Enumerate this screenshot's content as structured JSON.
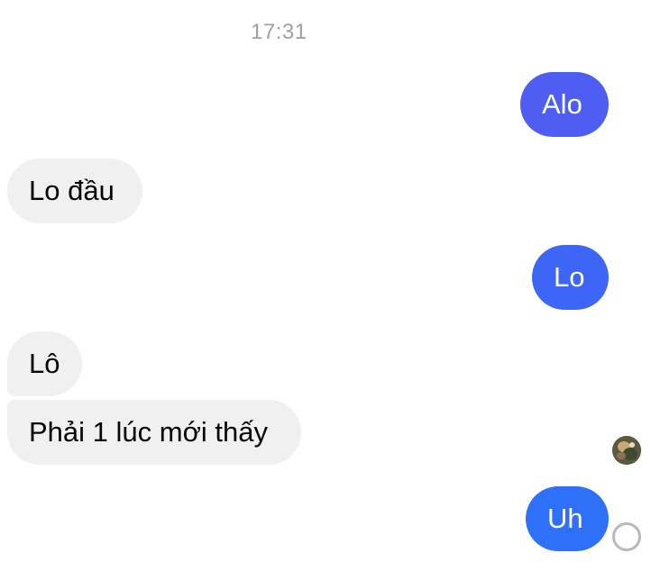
{
  "timestamp": "17:31",
  "colors": {
    "outgoing_1": "#4e5ef2",
    "outgoing_2": "#3d66f7",
    "outgoing_3": "#2f70f8",
    "incoming": "#f0f0f0",
    "timestamp": "#a0a0a4"
  },
  "messages": [
    {
      "direction": "outgoing",
      "text": "Alo"
    },
    {
      "direction": "incoming",
      "text": "Lo đầu"
    },
    {
      "direction": "outgoing",
      "text": "Lo"
    },
    {
      "direction": "incoming",
      "text": "Lô"
    },
    {
      "direction": "incoming",
      "text": "Phải 1 lúc mới thấy"
    },
    {
      "direction": "outgoing",
      "text": "Uh"
    }
  ],
  "read_receipt_icon": "avatar-seen",
  "send_status_icon": "sending-circle-icon"
}
